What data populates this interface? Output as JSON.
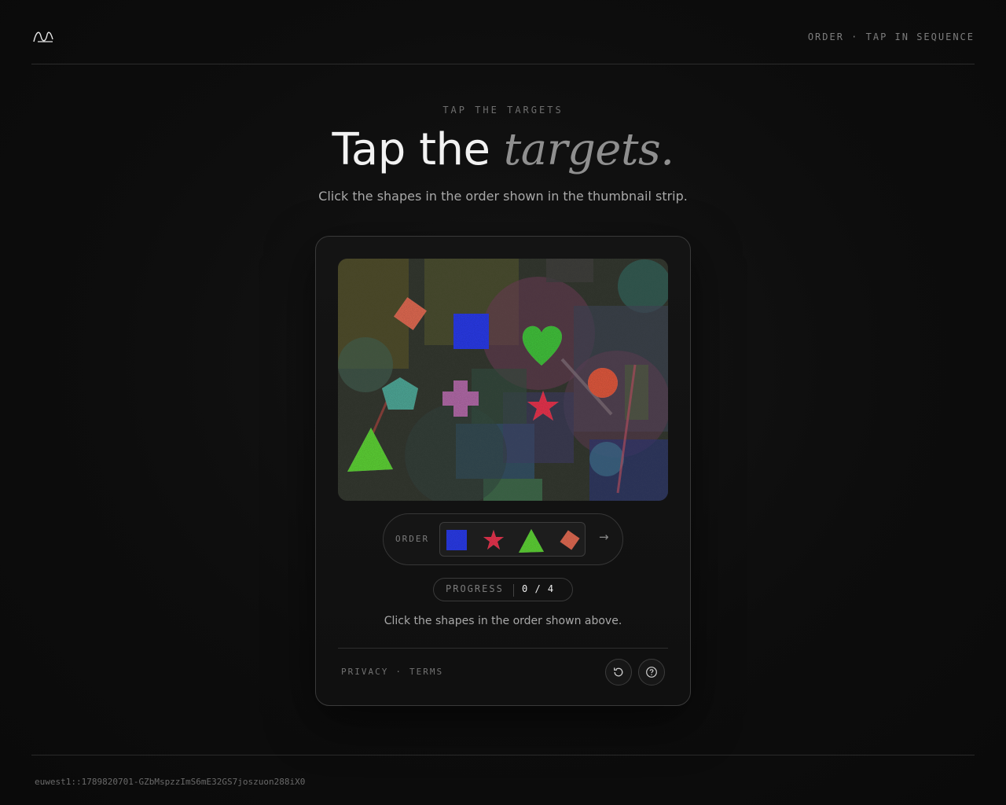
{
  "header": {
    "logo_icon": "wave-logo-icon",
    "tag": "ORDER · TAP IN SEQUENCE"
  },
  "hero": {
    "eyebrow": "TAP THE TARGETS",
    "title_plain": "Tap the ",
    "title_accent": "targets.",
    "subtitle": "Click the shapes in the order shown in the thumbnail strip."
  },
  "challenge": {
    "shapes": [
      {
        "name": "diamond",
        "color": "#e06a52"
      },
      {
        "name": "square",
        "color": "#2a3be8"
      },
      {
        "name": "heart",
        "color": "#42c23c"
      },
      {
        "name": "circle",
        "color": "#e0593e"
      },
      {
        "name": "pentagon",
        "color": "#4fa898"
      },
      {
        "name": "cross",
        "color": "#b26aa8"
      },
      {
        "name": "star",
        "color": "#e8344e"
      },
      {
        "name": "triangle",
        "color": "#5ed236"
      }
    ],
    "order_label": "ORDER",
    "order": [
      {
        "shape": "square",
        "color": "#2a3be8"
      },
      {
        "shape": "star",
        "color": "#e8344e"
      },
      {
        "shape": "triangle",
        "color": "#5ed236"
      },
      {
        "shape": "diamond",
        "color": "#e06a52"
      }
    ],
    "next_symbol": "→",
    "progress_label": "PROGRESS",
    "progress_value": "0 / 4",
    "progress_done": 0,
    "progress_total": 4,
    "instruction": "Click the shapes in the order shown above."
  },
  "card_footer": {
    "privacy": "PRIVACY",
    "separator": "·",
    "terms": "TERMS",
    "reload_icon": "reload-icon",
    "help_icon": "help-icon"
  },
  "footer": {
    "session_id": "euwest1::1789820701-GZbMspzzImS6mE32GS7joszuon288iX0"
  }
}
